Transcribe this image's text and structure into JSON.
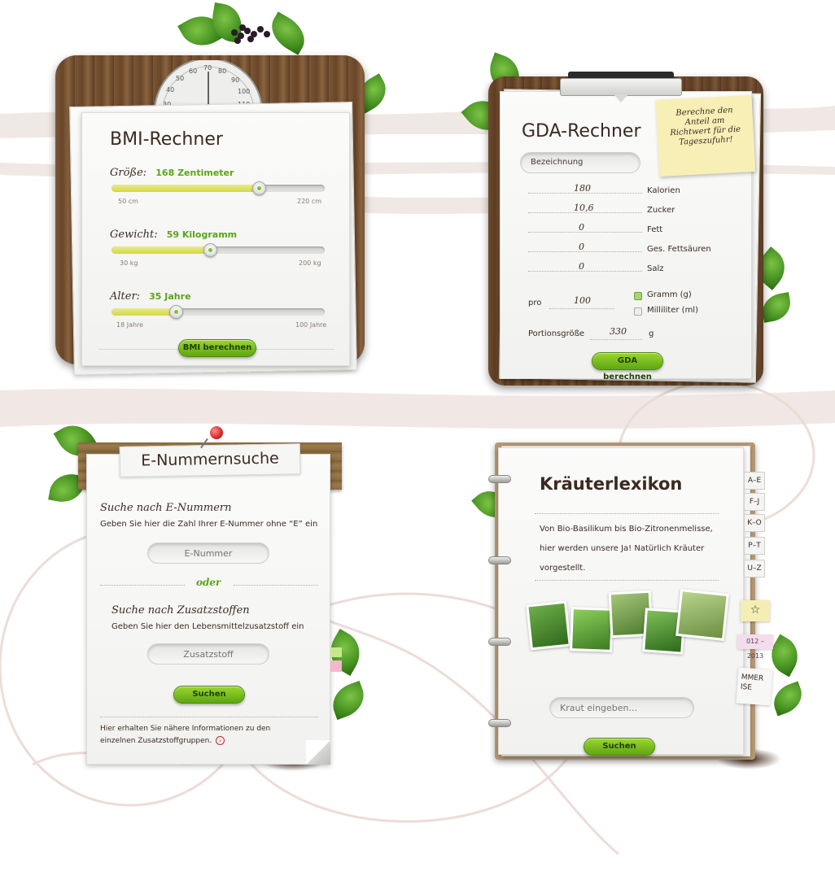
{
  "bmi": {
    "title": "BMI-Rechner",
    "gauge_ticks": [
      "30",
      "40",
      "50",
      "60",
      "70",
      "80",
      "90",
      "100",
      "110"
    ],
    "height_label": "Größe:",
    "height_value": "168 Zentimeter",
    "height_min": "50 cm",
    "height_max": "220 cm",
    "height_level": 0.69,
    "weight_label": "Gewicht:",
    "weight_value": "59 Kilogramm",
    "weight_min": "30 kg",
    "weight_max": "200 kg",
    "weight_level": 0.49,
    "age_label": "Alter:",
    "age_value": "35 Jahre",
    "age_min": "18 Jahre",
    "age_max": "100 Jahre",
    "age_level": 0.31,
    "button": "BMI berechnen"
  },
  "gda": {
    "title": "GDA-Rechner",
    "note": "Berechne den Anteil am Richtwert für die Tageszufuhr!",
    "name_placeholder": "Bezeichnung",
    "rows": [
      {
        "value": "180",
        "label": "Kalorien"
      },
      {
        "value": "10,6",
        "label": "Zucker"
      },
      {
        "value": "0",
        "label": "Fett"
      },
      {
        "value": "0",
        "label": "Ges. Fettsäuren"
      },
      {
        "value": "0",
        "label": "Salz"
      }
    ],
    "pro_label": "pro",
    "pro_value": "100",
    "unit_gram": "Gramm (g)",
    "unit_ml": "Milliliter (ml)",
    "portion_label": "Portionsgröße",
    "portion_value": "330",
    "portion_unit": "g",
    "button": "GDA berechnen"
  },
  "enum": {
    "title": "E-Nummernsuche",
    "search_title": "Suche nach E-Nummern",
    "search_desc": "Geben Sie hier die Zahl Ihrer E-Nummer ohne “E” ein",
    "input_placeholder": "E-Nummer",
    "oder": "oder",
    "additive_title": "Suche nach Zusatzstoffen",
    "additive_desc": "Geben Sie hier den Lebensmittelzusatzstoff ein",
    "additive_placeholder": "Zusatzstoff",
    "button": "Suchen",
    "info_text": "Hier erhalten Sie nähere Informationen zu den einzelnen Zusatzstoffgruppen."
  },
  "herbs": {
    "title": "Kräuterlexikon",
    "intro": "Von Bio-Basilikum bis Bio-Zitronenmelisse, hier werden unsere Ja! Natürlich Kräuter vorgestellt.",
    "tabs": [
      "A–E",
      "F–J",
      "K–O",
      "P–T",
      "U–Z"
    ],
    "side_note_date": "012 – 2013",
    "side_note_text": "MMER ISE",
    "input_placeholder": "Kraut eingeben...",
    "button": "Suchen"
  },
  "colors": {
    "green": "#6cb31a",
    "wood": "#6b4a2e",
    "accent_text": "#5ba419"
  }
}
